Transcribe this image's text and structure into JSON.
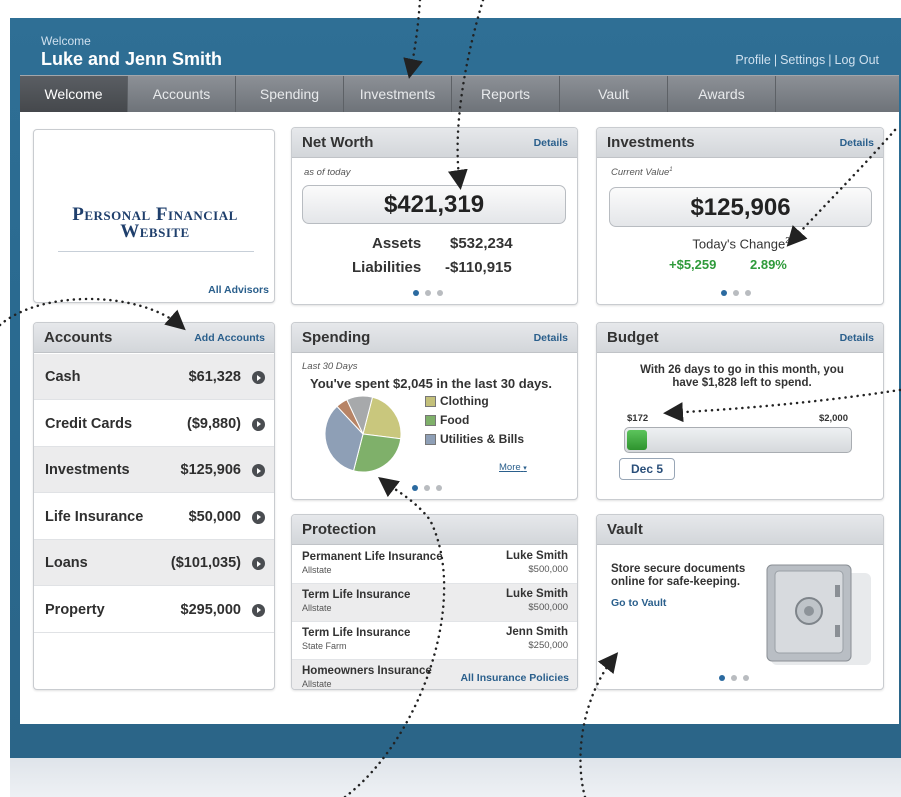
{
  "header": {
    "welcome": "Welcome",
    "name": "Luke and Jenn Smith",
    "links": [
      "Profile",
      "Settings",
      "Log Out"
    ],
    "separator": "|"
  },
  "nav": {
    "tabs": [
      "Welcome",
      "Accounts",
      "Spending",
      "Investments",
      "Reports",
      "Vault",
      "Awards"
    ],
    "active": "Welcome"
  },
  "logo": {
    "line1": "Personal Financial",
    "line2": "Website",
    "link": "All Advisors"
  },
  "accounts": {
    "title": "Accounts",
    "link": "Add Accounts",
    "items": [
      {
        "name": "Cash",
        "value": "$61,328"
      },
      {
        "name": "Credit Cards",
        "value": "($9,880)"
      },
      {
        "name": "Investments",
        "value": "$125,906"
      },
      {
        "name": "Life Insurance",
        "value": "$50,000"
      },
      {
        "name": "Loans",
        "value": "($101,035)"
      },
      {
        "name": "Property",
        "value": "$295,000"
      }
    ]
  },
  "networth": {
    "title": "Net Worth",
    "details": "Details",
    "as_of": "as of today",
    "value": "$421,319",
    "assets_label": "Assets",
    "assets": "$532,234",
    "liab_label": "Liabilities",
    "liab": "-$110,915",
    "page": 1,
    "pages": 3
  },
  "investments": {
    "title": "Investments",
    "details": "Details",
    "sub": "Current Value",
    "sub_sup": "1",
    "value": "$125,906",
    "change_label": "Today's Change",
    "change_sup": "2",
    "change_amt": "+$5,259",
    "change_pct": "2.89%",
    "page": 1,
    "pages": 3
  },
  "spending": {
    "title": "Spending",
    "details": "Details",
    "period": "Last 30 Days",
    "summary": "You've spent $2,045 in the last 30 days.",
    "legend": [
      {
        "label": "Clothing",
        "color": "#c3c07a"
      },
      {
        "label": "Food",
        "color": "#7fb06a"
      },
      {
        "label": "Utilities & Bills",
        "color": "#8e9fb6"
      }
    ],
    "more": "More",
    "page": 1,
    "pages": 3,
    "slices": [
      {
        "label": "Clothing",
        "fraction": 0.23,
        "color": "#c9c77d"
      },
      {
        "label": "Food",
        "fraction": 0.27,
        "color": "#7fb06a"
      },
      {
        "label": "Utilities & Bills",
        "fraction": 0.34,
        "color": "#8e9fb6"
      },
      {
        "label": "",
        "fraction": 0.05,
        "color": "#b78466"
      },
      {
        "label": "",
        "fraction": 0.11,
        "color": "#a7a9ab"
      }
    ]
  },
  "budget": {
    "title": "Budget",
    "details": "Details",
    "message": "With 26 days to go in this month, you have $1,828 left to spend.",
    "spent": "$172",
    "limit": "$2,000",
    "spent_fraction": 0.086,
    "date": "Dec 5",
    "accent": "#3aa83a"
  },
  "protection": {
    "title": "Protection",
    "link": "All Insurance Policies",
    "policies": [
      {
        "name": "Permanent Life Insurance",
        "company": "Allstate",
        "owner": "Luke Smith",
        "amount": "$500,000"
      },
      {
        "name": "Term Life Insurance",
        "company": "Allstate",
        "owner": "Luke Smith",
        "amount": "$500,000"
      },
      {
        "name": "Term Life Insurance",
        "company": "State Farm",
        "owner": "Jenn Smith",
        "amount": "$250,000"
      },
      {
        "name": "Homeowners Insurance",
        "company": "Allstate",
        "owner": "",
        "amount": ""
      }
    ]
  },
  "vault": {
    "title": "Vault",
    "text": "Store secure documents online for safe-keeping.",
    "link": "Go to Vault",
    "page": 1,
    "pages": 3
  },
  "colors": {
    "frame": "#2b6588",
    "accent_link": "#2a5f8c",
    "positive": "#2e9a3a",
    "dot_active": "#2b6aa0"
  }
}
